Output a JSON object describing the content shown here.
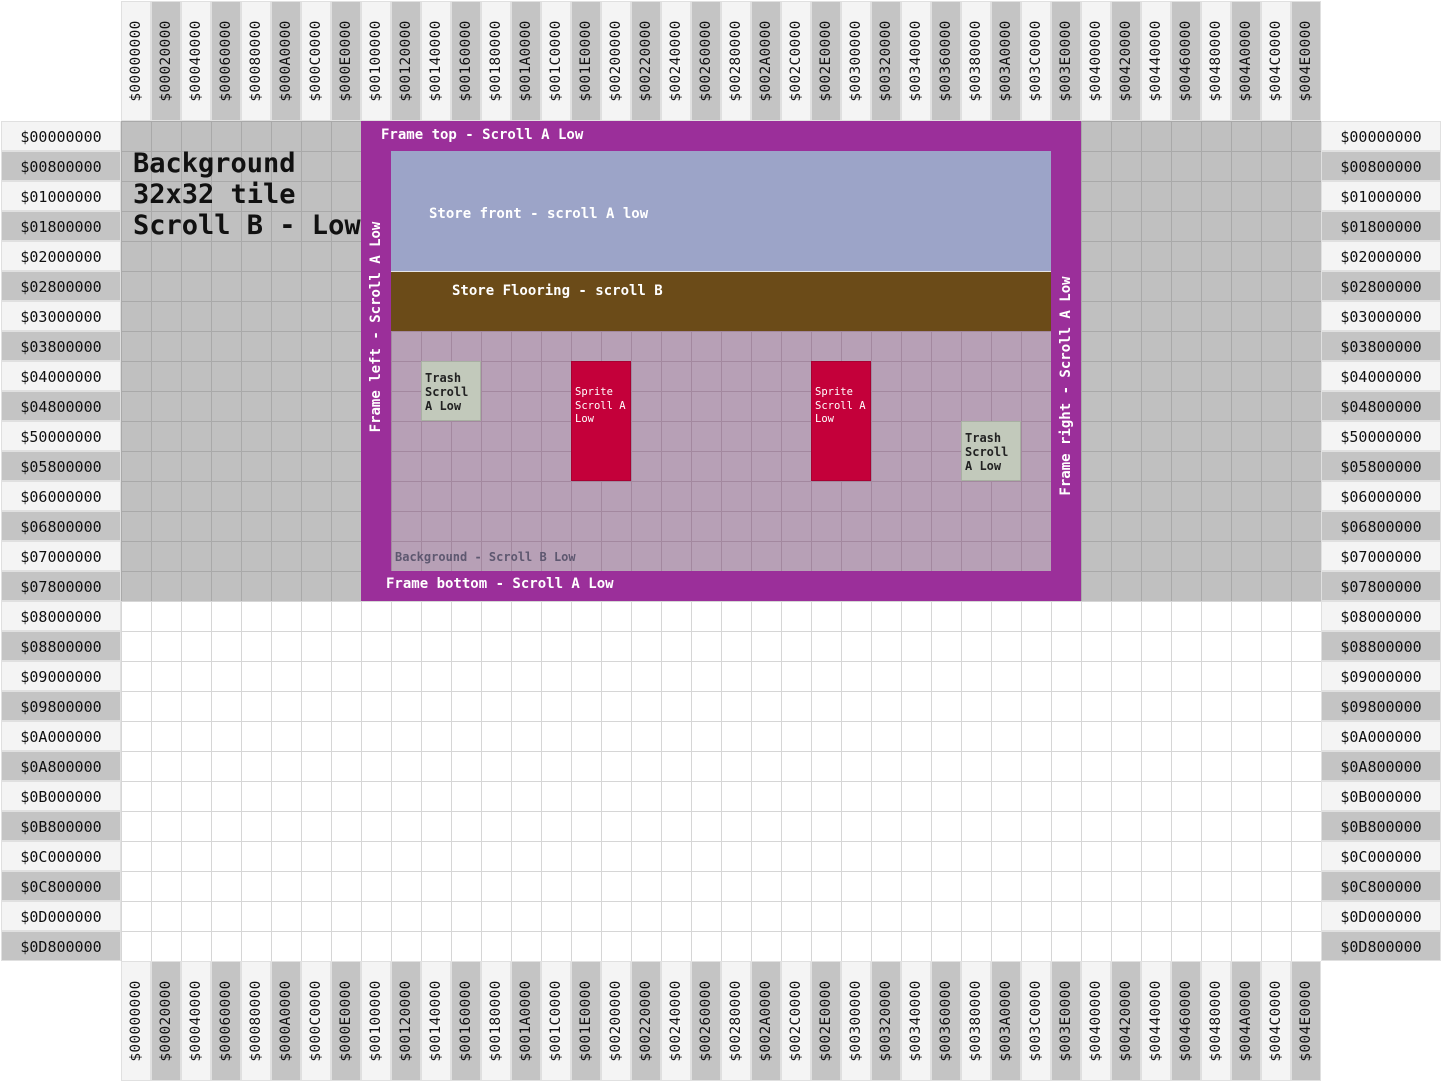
{
  "columns": [
    "$00000000",
    "$00020000",
    "$00040000",
    "$00060000",
    "$00080000",
    "$000A0000",
    "$000C0000",
    "$000E0000",
    "$00100000",
    "$00120000",
    "$00140000",
    "$00160000",
    "$00180000",
    "$001A0000",
    "$001C0000",
    "$001E0000",
    "$00200000",
    "$00220000",
    "$00240000",
    "$00260000",
    "$00280000",
    "$002A0000",
    "$002C0000",
    "$002E0000",
    "$00300000",
    "$00320000",
    "$00340000",
    "$00360000",
    "$00380000",
    "$003A0000",
    "$003C0000",
    "$003E0000",
    "$00400000",
    "$00420000",
    "$00440000",
    "$00460000",
    "$00480000",
    "$004A0000",
    "$004C0000",
    "$004E0000"
  ],
  "rows": [
    "$00000000",
    "$00800000",
    "$01000000",
    "$01800000",
    "$02000000",
    "$02800000",
    "$03000000",
    "$03800000",
    "$04000000",
    "$04800000",
    "$50000000",
    "$05800000",
    "$06000000",
    "$06800000",
    "$07000000",
    "$07800000",
    "$08000000",
    "$08800000",
    "$09000000",
    "$09800000",
    "$0A000000",
    "$0A800000",
    "$0B000000",
    "$0B800000",
    "$0C000000",
    "$0C800000",
    "$0D000000",
    "$0D800000"
  ],
  "labels": {
    "background_title": "Background\n32x32 tile\nScroll B - Low",
    "frame_top": "Frame top - Scroll A Low",
    "frame_bottom": "Frame bottom - Scroll A Low",
    "frame_left": "Frame left - Scroll A Low",
    "frame_right": "Frame right - Scroll A Low",
    "store_front": "Store front - scroll A low",
    "store_flooring": "Store Flooring - scroll B",
    "background_small": "Background - Scroll B Low",
    "trash_1": "Trash\nScroll\nA Low",
    "trash_2": "Trash\nScroll\nA Low",
    "sprite_1": "Sprite\nScroll A\nLow",
    "sprite_2": "Sprite\nScroll A\nLow"
  },
  "colors": {
    "frame": "#9b2f9a",
    "store_front": "#9ca4c8",
    "store_flooring": "#6b4b18",
    "floor_background": "#b7a0b6",
    "sprite": "#c4003a",
    "trash": "#c2c9bb",
    "background_tiles": "#c0c0c0"
  }
}
